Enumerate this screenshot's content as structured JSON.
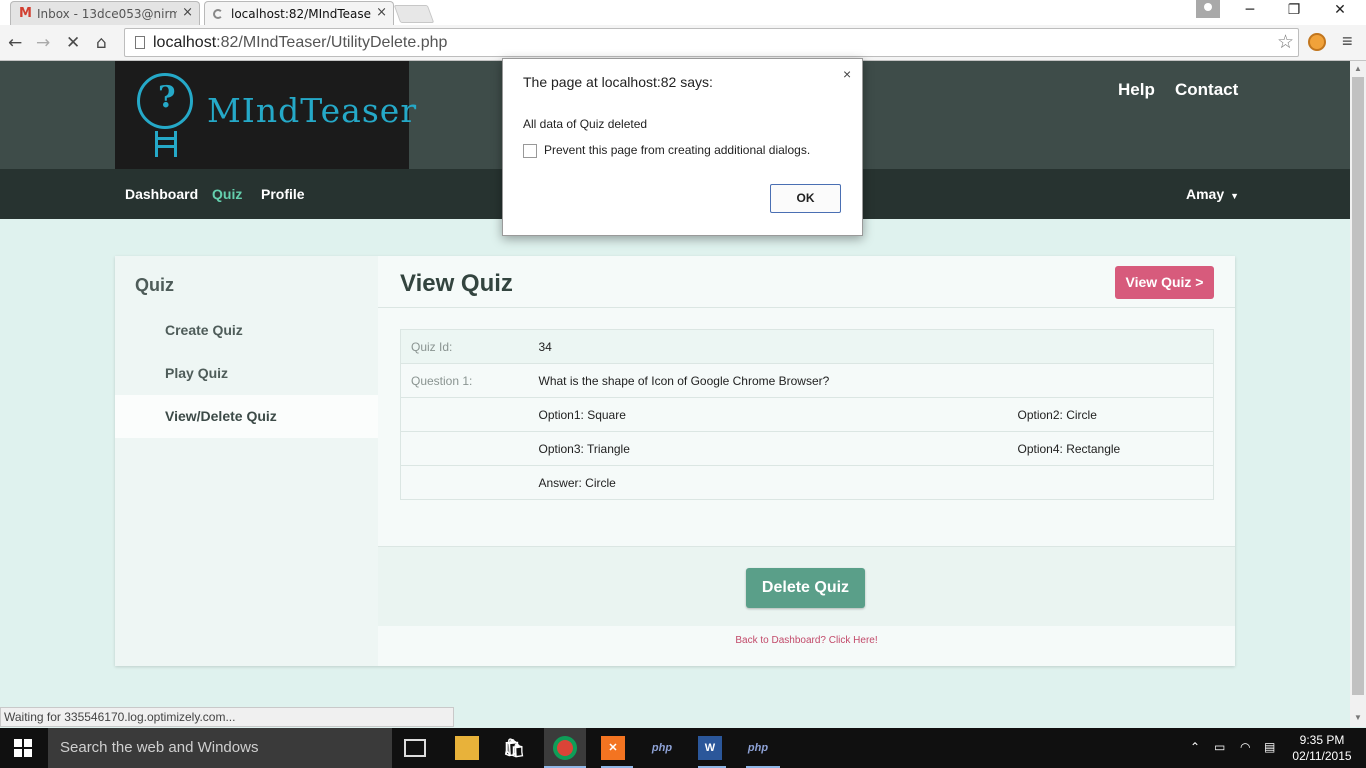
{
  "browser": {
    "tabs": [
      {
        "title": "Inbox - 13dce053@nirma",
        "close": "×"
      },
      {
        "title": "localhost:82/MIndTeaser/U",
        "close": "×"
      }
    ],
    "url_host": "localhost",
    "url_path": ":82/MIndTeaser/UtilityDelete.php",
    "window_buttons": {
      "minimize": "─",
      "restore": "❐",
      "close": "✕"
    }
  },
  "site": {
    "logo_text": "MIndTeaser",
    "top_links": [
      "Help",
      "Contact"
    ],
    "nav": {
      "items": [
        "Dashboard",
        "Quiz",
        "Profile"
      ],
      "active": "Quiz",
      "user": "Amay"
    }
  },
  "sidebar": {
    "title": "Quiz",
    "items": [
      "Create Quiz",
      "Play Quiz",
      "View/Delete Quiz"
    ],
    "selected": "View/Delete Quiz"
  },
  "main": {
    "title": "View Quiz",
    "view_button": "View Quiz >",
    "quiz": {
      "id_label": "Quiz Id:",
      "id_value": "34",
      "question_label": "Question 1:",
      "question": "What is the shape of Icon of Google Chrome Browser?",
      "option1": "Option1: Square",
      "option2": "Option2: Circle",
      "option3": "Option3: Triangle",
      "option4": "Option4: Rectangle",
      "answer": "Answer: Circle"
    },
    "delete_button": "Delete Quiz",
    "back_link": "Back to Dashboard? Click Here!"
  },
  "dialog": {
    "title": "The page at localhost:82 says:",
    "message": "All data of Quiz deleted",
    "checkbox_label": "Prevent this page from creating additional dialogs.",
    "ok": "OK",
    "close": "×"
  },
  "status": "Waiting for 335546170.log.optimizely.com...",
  "taskbar": {
    "search_placeholder": "Search the web and Windows",
    "time": "9:35 PM",
    "date": "02/11/2015"
  }
}
